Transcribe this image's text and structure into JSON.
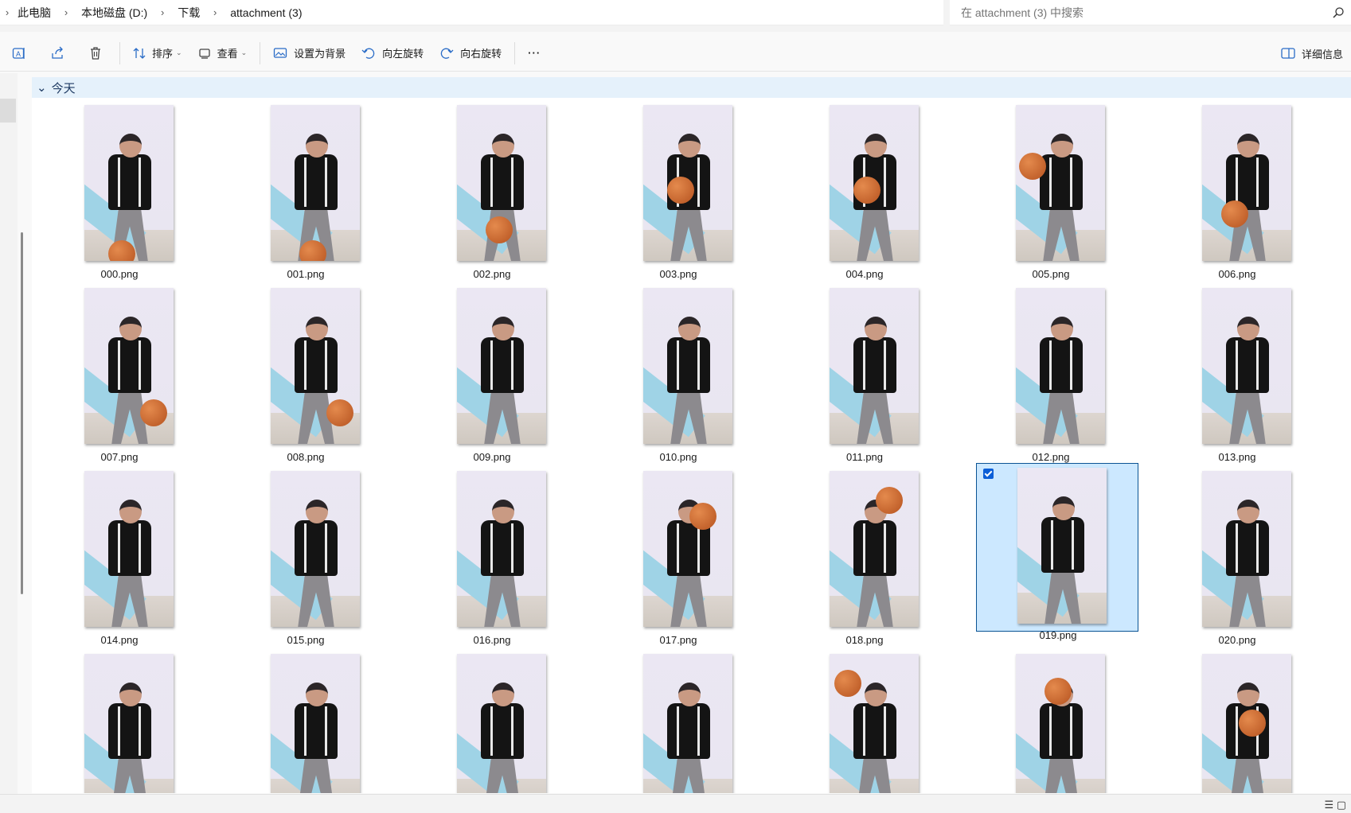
{
  "breadcrumb": {
    "items": [
      "此电脑",
      "本地磁盘 (D:)",
      "下载",
      "attachment (3)"
    ]
  },
  "search": {
    "placeholder": "在 attachment (3) 中搜索"
  },
  "toolbar": {
    "sort_label": "排序",
    "view_label": "查看",
    "set_background_label": "设置为背景",
    "rotate_left_label": "向左旋转",
    "rotate_right_label": "向右旋转",
    "more_label": "···",
    "details_label": "详细信息"
  },
  "group": {
    "title": "今天"
  },
  "files": [
    {
      "name": "000.png",
      "selected": false
    },
    {
      "name": "001.png",
      "selected": false
    },
    {
      "name": "002.png",
      "selected": false
    },
    {
      "name": "003.png",
      "selected": false
    },
    {
      "name": "004.png",
      "selected": false
    },
    {
      "name": "005.png",
      "selected": false
    },
    {
      "name": "006.png",
      "selected": false
    },
    {
      "name": "007.png",
      "selected": false
    },
    {
      "name": "008.png",
      "selected": false
    },
    {
      "name": "009.png",
      "selected": false
    },
    {
      "name": "010.png",
      "selected": false
    },
    {
      "name": "011.png",
      "selected": false
    },
    {
      "name": "012.png",
      "selected": false
    },
    {
      "name": "013.png",
      "selected": false
    },
    {
      "name": "014.png",
      "selected": false
    },
    {
      "name": "015.png",
      "selected": false
    },
    {
      "name": "016.png",
      "selected": false
    },
    {
      "name": "017.png",
      "selected": false
    },
    {
      "name": "018.png",
      "selected": false
    },
    {
      "name": "019.png",
      "selected": true
    },
    {
      "name": "020.png",
      "selected": false
    },
    {
      "name": "",
      "selected": false
    },
    {
      "name": "",
      "selected": false
    },
    {
      "name": "",
      "selected": false
    },
    {
      "name": "",
      "selected": false
    },
    {
      "name": "",
      "selected": false
    },
    {
      "name": "",
      "selected": false
    },
    {
      "name": "",
      "selected": false
    }
  ],
  "colors": {
    "accent": "#0b5ed7",
    "selection_bg": "#cce8ff",
    "group_header_bg": "#e5f1fb"
  }
}
